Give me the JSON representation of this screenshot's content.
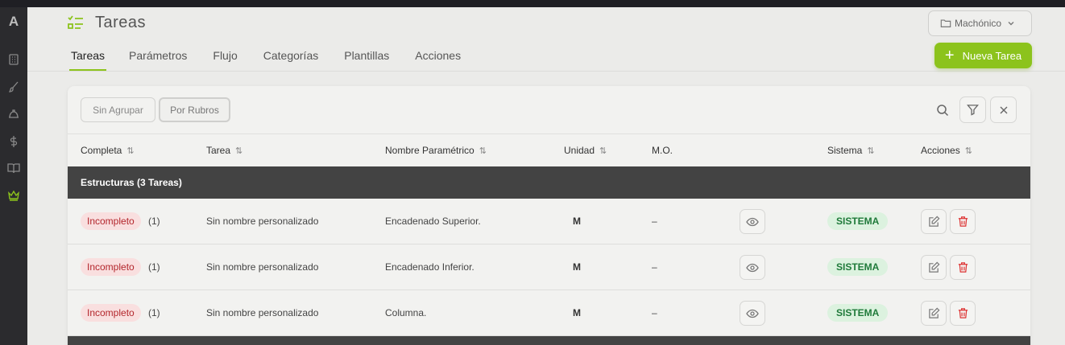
{
  "sidebar": {
    "logo": "A",
    "items": [
      {
        "icon": "building-icon"
      },
      {
        "icon": "brush-icon"
      },
      {
        "icon": "helmet-icon"
      },
      {
        "icon": "dollar-icon"
      },
      {
        "icon": "book-icon"
      },
      {
        "icon": "crown-icon",
        "active": true
      }
    ]
  },
  "header": {
    "title": "Tareas",
    "project": "Machónico",
    "new_button": "Nueva Tarea",
    "accent": "#8cc31c"
  },
  "tabs": [
    {
      "label": "Tareas",
      "active": true
    },
    {
      "label": "Parámetros"
    },
    {
      "label": "Flujo"
    },
    {
      "label": "Categorías"
    },
    {
      "label": "Plantillas"
    },
    {
      "label": "Acciones"
    }
  ],
  "toolbar": {
    "group_options": [
      "Sin Agrupar",
      "Por Rubros"
    ],
    "selected_group": "Por Rubros"
  },
  "table": {
    "columns": [
      {
        "label": "Completa",
        "sortable": true
      },
      {
        "label": "Tarea",
        "sortable": true
      },
      {
        "label": "Nombre Paramétrico",
        "sortable": true
      },
      {
        "label": "Unidad",
        "sortable": true
      },
      {
        "label": "M.O.",
        "sortable": false
      },
      {
        "label": "Sistema",
        "sortable": true
      },
      {
        "label": "Acciones",
        "sortable": true
      }
    ],
    "sort_glyph": "⇅",
    "group": "Estructuras (3 Tareas)",
    "rows": [
      {
        "status": "Incompleto",
        "count": "(1)",
        "task": "Sin nombre personalizado",
        "param": "Encadenado Superior.",
        "unit": "M",
        "mo": "–",
        "system": "SISTEMA"
      },
      {
        "status": "Incompleto",
        "count": "(1)",
        "task": "Sin nombre personalizado",
        "param": "Encadenado Inferior.",
        "unit": "M",
        "mo": "–",
        "system": "SISTEMA"
      },
      {
        "status": "Incompleto",
        "count": "(1)",
        "task": "Sin nombre personalizado",
        "param": "Columna.",
        "unit": "M",
        "mo": "–",
        "system": "SISTEMA"
      }
    ]
  }
}
